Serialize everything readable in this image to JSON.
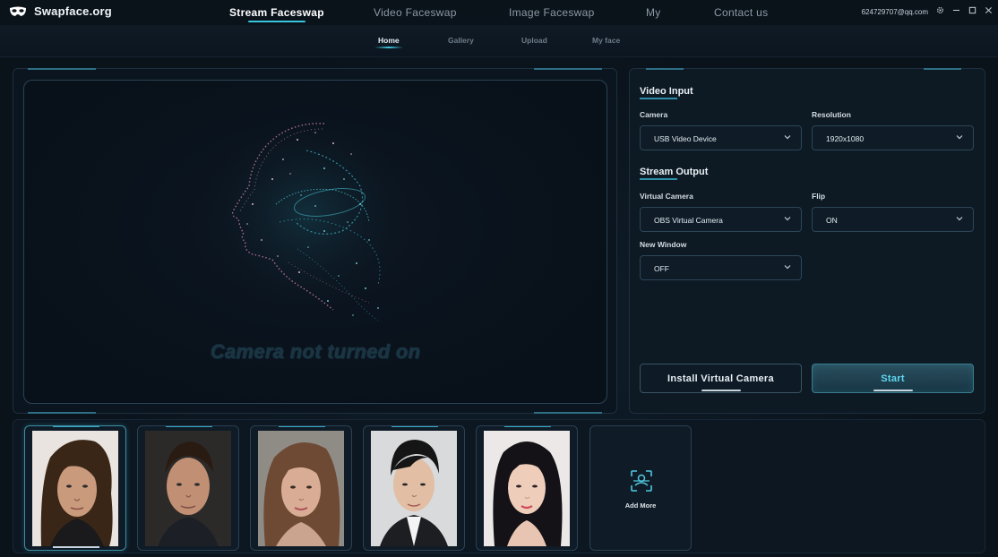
{
  "app": {
    "name": "Swapface.org"
  },
  "nav": {
    "items": [
      {
        "label": "Stream Faceswap",
        "active": true
      },
      {
        "label": "Video Faceswap",
        "active": false
      },
      {
        "label": "Image Faceswap",
        "active": false
      },
      {
        "label": "My",
        "active": false
      },
      {
        "label": "Contact us",
        "active": false
      }
    ]
  },
  "account": {
    "email": "624729707@qq.com"
  },
  "window": {
    "settings_icon": "gear-icon",
    "min_icon": "minimize-icon",
    "max_icon": "maximize-icon",
    "close_icon": "close-icon"
  },
  "subnav": {
    "items": [
      {
        "label": "Home",
        "active": true
      },
      {
        "label": "Gallery",
        "active": false
      },
      {
        "label": "Upload",
        "active": false
      },
      {
        "label": "My face",
        "active": false
      }
    ]
  },
  "preview": {
    "status": "Camera not turned on"
  },
  "video_input": {
    "title": "Video Input",
    "camera": {
      "label": "Camera",
      "value": "USB Video Device"
    },
    "resolution": {
      "label": "Resolution",
      "value": "1920x1080"
    }
  },
  "stream_output": {
    "title": "Stream Output",
    "virtual_camera": {
      "label": "Virtual Camera",
      "value": "OBS Virtual Camera"
    },
    "flip": {
      "label": "Flip",
      "value": "ON"
    },
    "new_window": {
      "label": "New Window",
      "value": "OFF"
    }
  },
  "actions": {
    "install_label": "Install Virtual Camera",
    "start_label": "Start"
  },
  "faces": {
    "selected_index": 0,
    "add_more_label": "Add More"
  },
  "colors": {
    "accent": "#3fc7e0",
    "background": "#0b131c",
    "panel": "#0d1923",
    "border": "#2c4658"
  }
}
